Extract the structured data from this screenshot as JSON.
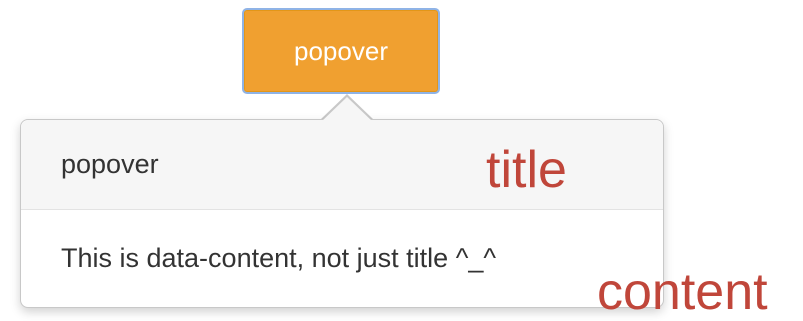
{
  "trigger": {
    "label": "popover",
    "color": "#f0a030"
  },
  "popover": {
    "title": "popover",
    "content": "This is data-content, not just title ^_^"
  },
  "annotations": {
    "title_label": "title",
    "content_label": "content",
    "color": "#c0463a"
  }
}
